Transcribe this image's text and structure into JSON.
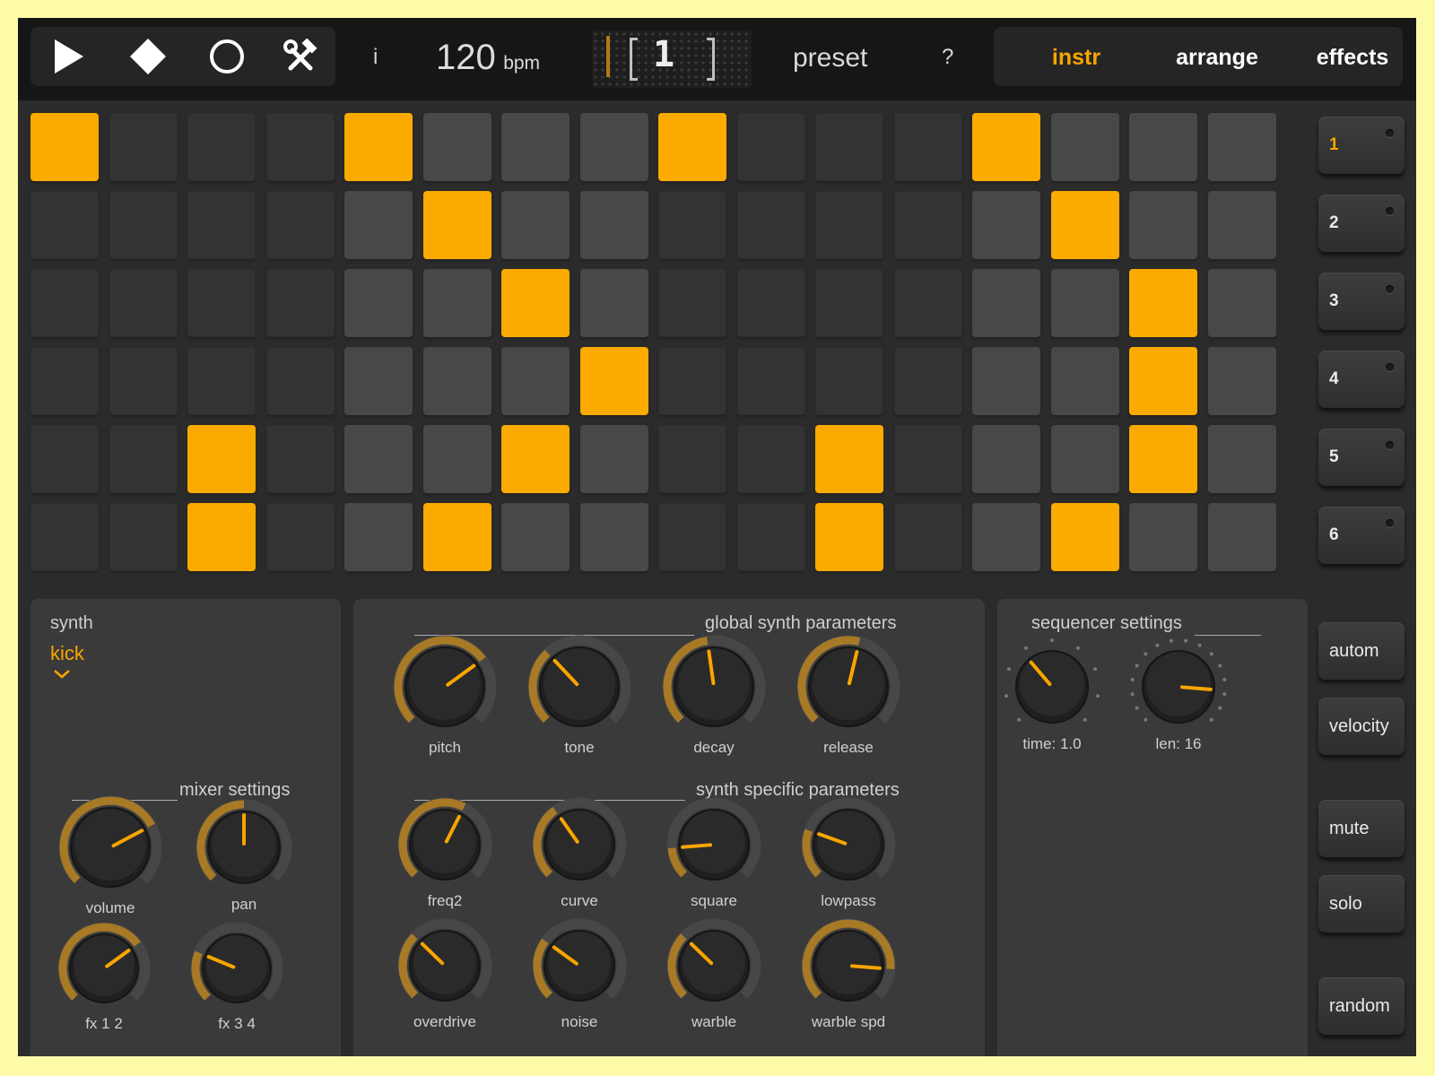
{
  "transport": {
    "play_icon": "play-icon",
    "stop_icon": "diamond-stop-icon",
    "record_icon": "circle-record-icon",
    "tools_icon": "hammer-wrench-icon"
  },
  "header": {
    "info_label": "i",
    "tempo_value": "120",
    "tempo_unit": "bpm",
    "pattern_display": "1",
    "preset_label": "preset",
    "help_label": "?"
  },
  "tabs": [
    {
      "label": "instr",
      "active": true
    },
    {
      "label": "arrange",
      "active": false
    },
    {
      "label": "effects",
      "active": false
    }
  ],
  "grid": {
    "steps": 16,
    "rows": [
      {
        "active": [
          0,
          4,
          8,
          12
        ]
      },
      {
        "active": [
          5,
          13
        ]
      },
      {
        "active": [
          6,
          14
        ]
      },
      {
        "active": [
          7,
          14
        ]
      },
      {
        "active": [
          2,
          6,
          10,
          14
        ]
      },
      {
        "active": [
          2,
          5,
          10,
          13
        ]
      }
    ]
  },
  "tracks": [
    {
      "label": "1",
      "selected": true
    },
    {
      "label": "2",
      "selected": false
    },
    {
      "label": "3",
      "selected": false
    },
    {
      "label": "4",
      "selected": false
    },
    {
      "label": "5",
      "selected": false
    },
    {
      "label": "6",
      "selected": false
    }
  ],
  "side_buttons": {
    "autom": "autom",
    "velocity": "velocity",
    "mute": "mute",
    "solo": "solo",
    "random": "random"
  },
  "synth_panel": {
    "title": "synth",
    "instrument": "kick",
    "dropdown_icon": "chevron-down-icon",
    "mixer_title": "mixer settings",
    "knobs": [
      {
        "label": "volume",
        "value": 0.73
      },
      {
        "label": "pan",
        "value": 0.5
      },
      {
        "label": "fx 1 2",
        "value": 0.7
      },
      {
        "label": "fx 3 4",
        "value": 0.25
      }
    ]
  },
  "global_panel": {
    "title": "global synth parameters",
    "knobs": [
      {
        "label": "pitch",
        "value": 0.7
      },
      {
        "label": "tone",
        "value": 0.34
      },
      {
        "label": "decay",
        "value": 0.47
      },
      {
        "label": "release",
        "value": 0.55
      }
    ],
    "specific_title": "synth specific parameters",
    "specific_knobs": [
      {
        "label": "freq2",
        "value": 0.6
      },
      {
        "label": "curve",
        "value": 0.37
      },
      {
        "label": "square",
        "value": 0.15
      },
      {
        "label": "lowpass",
        "value": 0.24
      },
      {
        "label": "overdrive",
        "value": 0.33
      },
      {
        "label": "noise",
        "value": 0.3
      },
      {
        "label": "warble",
        "value": 0.33
      },
      {
        "label": "warble spd",
        "value": 0.85
      }
    ]
  },
  "sequencer_panel": {
    "title": "sequencer settings",
    "knobs": [
      {
        "label": "time: 1.0",
        "value": 0.35
      },
      {
        "label": "len: 16",
        "value": 0.85
      }
    ]
  },
  "colors": {
    "accent": "#f9a500",
    "pad_on": "#fbab00",
    "pad_dark": "#333333",
    "pad_light": "#484848",
    "panel": "#3a3a3a",
    "background": "#2b2b2b",
    "frame": "#fdfba8"
  }
}
